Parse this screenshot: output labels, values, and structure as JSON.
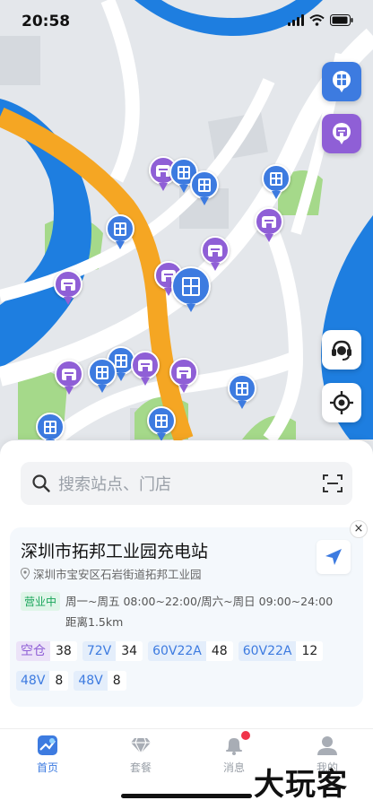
{
  "status_bar": {
    "time": "20:58"
  },
  "map": {
    "pin_types": {
      "station": "charging-station-icon",
      "shop": "store-icon"
    },
    "colors": {
      "station": "#3d7be0",
      "shop": "#8f5fd6",
      "road_main": "#f5a623",
      "water": "#1e7ee0",
      "park": "#a5d98a"
    }
  },
  "search": {
    "placeholder": "搜索站点、门店"
  },
  "station": {
    "name": "深圳市拓邦工业园充电站",
    "address": "深圳市宝安区石岩街道拓邦工业园",
    "status": "营业中",
    "hours": "周一~周五 08:00~22:00/周六~周日 09:00~24:00",
    "distance": "距离1.5km",
    "slots_row1": [
      {
        "type": "空仓",
        "count": "38",
        "color": "purple"
      },
      {
        "type": "72V",
        "count": "34",
        "color": "blue"
      },
      {
        "type": "60V22A",
        "count": "48",
        "color": "blue"
      },
      {
        "type": "60V22A",
        "count": "12",
        "color": "blue"
      }
    ],
    "slots_row2": [
      {
        "type": "48V",
        "count": "8",
        "color": "blue"
      },
      {
        "type": "48V",
        "count": "8",
        "color": "blue"
      }
    ]
  },
  "tabs": [
    {
      "label": "首页",
      "icon": "home-map-icon",
      "active": true
    },
    {
      "label": "套餐",
      "icon": "diamond-icon",
      "active": false
    },
    {
      "label": "消息",
      "icon": "bell-icon",
      "active": false,
      "badge": true
    },
    {
      "label": "我的",
      "icon": "user-icon",
      "active": false
    }
  ],
  "watermark": "大玩客"
}
